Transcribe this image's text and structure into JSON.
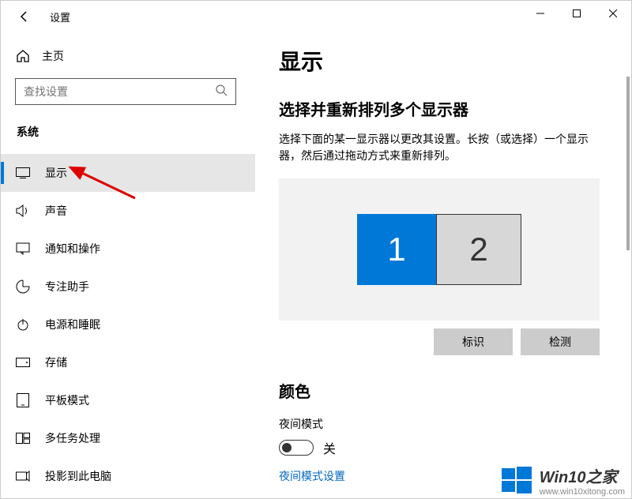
{
  "titlebar": {
    "appTitle": "设置"
  },
  "sidebar": {
    "homeLabel": "主页",
    "searchPlaceholder": "查找设置",
    "categoryLabel": "系统",
    "items": [
      {
        "label": "显示"
      },
      {
        "label": "声音"
      },
      {
        "label": "通知和操作"
      },
      {
        "label": "专注助手"
      },
      {
        "label": "电源和睡眠"
      },
      {
        "label": "存储"
      },
      {
        "label": "平板模式"
      },
      {
        "label": "多任务处理"
      },
      {
        "label": "投影到此电脑"
      }
    ]
  },
  "content": {
    "pageTitle": "显示",
    "arrangeHeading": "选择并重新排列多个显示器",
    "arrangeDesc": "选择下面的某一显示器以更改其设置。长按（或选择）一个显示器，然后通过拖动方式来重新排列。",
    "monitors": {
      "primary": "1",
      "secondary": "2"
    },
    "identifyBtn": "标识",
    "detectBtn": "检测",
    "colorHeading": "颜色",
    "nightLightLabel": "夜间模式",
    "toggleStateLabel": "关",
    "nightLightLink": "夜间模式设置"
  },
  "watermark": {
    "brand": "Win10之家",
    "url": "www.win10xitong.com"
  }
}
